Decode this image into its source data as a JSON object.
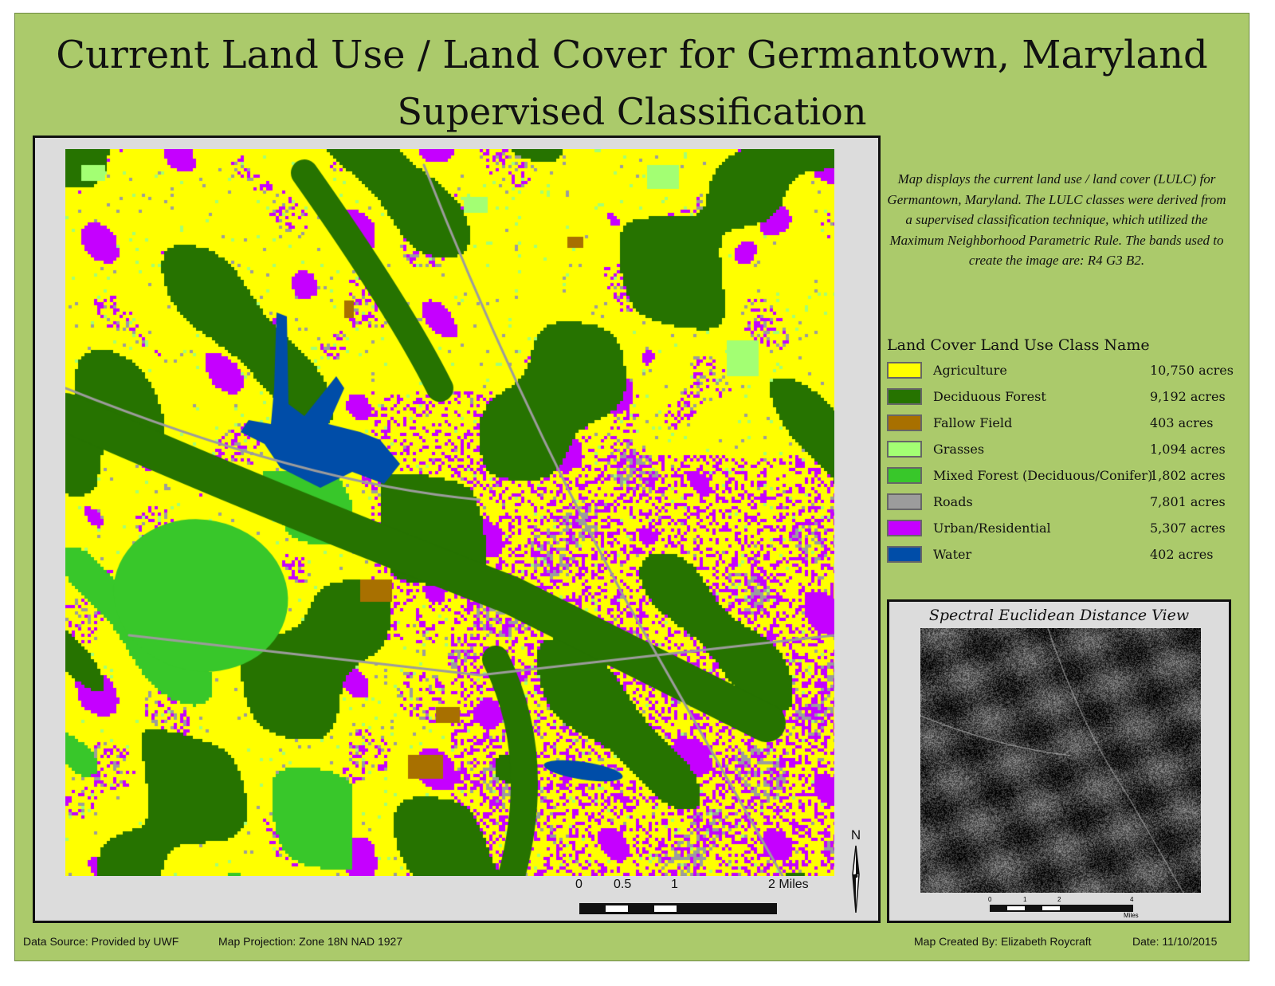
{
  "title_line1": "Current  Land Use / Land Cover for Germantown, Maryland",
  "title_line2": "Supervised Classification",
  "description": "Map displays the current land use / land cover (LULC) for Germantown, Maryland.  The LULC classes were derived from a supervised classification technique, which utilized the Maximum Neighborhood Parametric Rule.  The bands used to create the image are: R4 G3 B2.",
  "legend": {
    "title": "Land Cover Land Use Class Name",
    "classes": [
      {
        "name": "Agriculture",
        "area": "10,750 acres",
        "color": "#ffff00"
      },
      {
        "name": "Deciduous Forest",
        "area": "9,192 acres",
        "color": "#267300"
      },
      {
        "name": "Fallow Field",
        "area": "403 acres",
        "color": "#a87000"
      },
      {
        "name": "Grasses",
        "area": "1,094 acres",
        "color": "#a3ff73"
      },
      {
        "name": "Mixed Forest (Deciduous/Conifer)",
        "area": "1,802 acres",
        "color": "#38c72a"
      },
      {
        "name": "Roads",
        "area": "7,801 acres",
        "color": "#9c9c9c"
      },
      {
        "name": "Urban/Residential",
        "area": "5,307 acres",
        "color": "#c500ff"
      },
      {
        "name": "Water",
        "area": "402 acres",
        "color": "#004da8"
      }
    ]
  },
  "scale_bar": {
    "labels": [
      "0",
      "0.5",
      "1",
      "2 Miles"
    ]
  },
  "north_label": "N",
  "inset": {
    "title": "Spectral Euclidean Distance View",
    "scale_labels": [
      "0",
      "1",
      "2",
      "4"
    ],
    "scale_units": "Miles"
  },
  "footer": {
    "data_source": "Data Source: Provided by UWF",
    "projection": "Map Projection: Zone 18N NAD 1927",
    "created_by": "Map Created By: Elizabeth Roycraft",
    "date": "Date: 11/10/2015"
  }
}
